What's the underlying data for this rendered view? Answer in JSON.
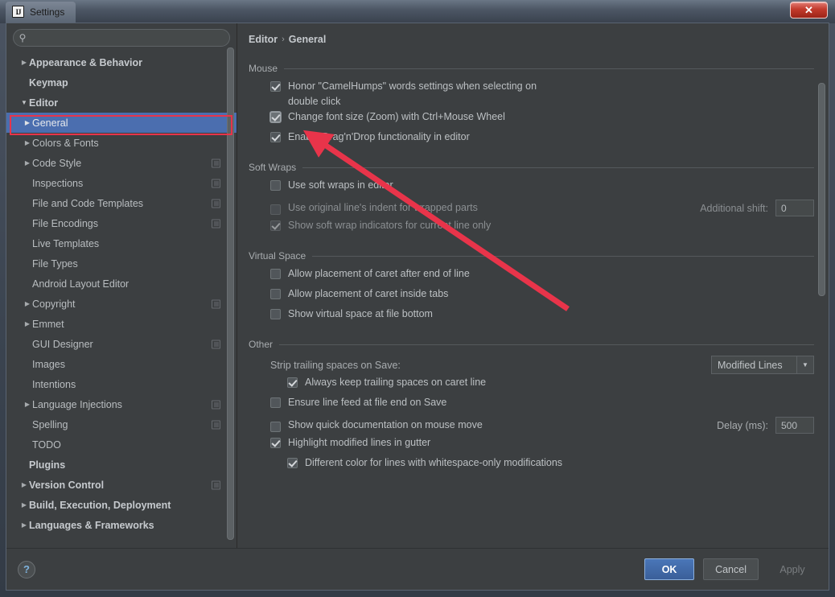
{
  "window": {
    "title": "Settings",
    "logo_text": "IJ",
    "close_label": "✕"
  },
  "sidebar": {
    "search": {
      "value": "",
      "placeholder": "",
      "icon": "search-icon"
    },
    "items": [
      {
        "label": "Appearance & Behavior",
        "indent": 0,
        "arrow": "▶",
        "bold": true,
        "selected": false,
        "cfg": false
      },
      {
        "label": "Keymap",
        "indent": 0,
        "arrow": "",
        "bold": true,
        "selected": false,
        "cfg": false
      },
      {
        "label": "Editor",
        "indent": 0,
        "arrow": "▼",
        "bold": true,
        "selected": false,
        "cfg": false
      },
      {
        "label": "General",
        "indent": 1,
        "arrow": "▶",
        "bold": false,
        "selected": true,
        "cfg": false
      },
      {
        "label": "Colors & Fonts",
        "indent": 1,
        "arrow": "▶",
        "bold": false,
        "selected": false,
        "cfg": false
      },
      {
        "label": "Code Style",
        "indent": 1,
        "arrow": "▶",
        "bold": false,
        "selected": false,
        "cfg": true
      },
      {
        "label": "Inspections",
        "indent": 1,
        "arrow": "",
        "bold": false,
        "selected": false,
        "cfg": true
      },
      {
        "label": "File and Code Templates",
        "indent": 1,
        "arrow": "",
        "bold": false,
        "selected": false,
        "cfg": true
      },
      {
        "label": "File Encodings",
        "indent": 1,
        "arrow": "",
        "bold": false,
        "selected": false,
        "cfg": true
      },
      {
        "label": "Live Templates",
        "indent": 1,
        "arrow": "",
        "bold": false,
        "selected": false,
        "cfg": false
      },
      {
        "label": "File Types",
        "indent": 1,
        "arrow": "",
        "bold": false,
        "selected": false,
        "cfg": false
      },
      {
        "label": "Android Layout Editor",
        "indent": 1,
        "arrow": "",
        "bold": false,
        "selected": false,
        "cfg": false
      },
      {
        "label": "Copyright",
        "indent": 1,
        "arrow": "▶",
        "bold": false,
        "selected": false,
        "cfg": true
      },
      {
        "label": "Emmet",
        "indent": 1,
        "arrow": "▶",
        "bold": false,
        "selected": false,
        "cfg": false
      },
      {
        "label": "GUI Designer",
        "indent": 1,
        "arrow": "",
        "bold": false,
        "selected": false,
        "cfg": true
      },
      {
        "label": "Images",
        "indent": 1,
        "arrow": "",
        "bold": false,
        "selected": false,
        "cfg": false
      },
      {
        "label": "Intentions",
        "indent": 1,
        "arrow": "",
        "bold": false,
        "selected": false,
        "cfg": false
      },
      {
        "label": "Language Injections",
        "indent": 1,
        "arrow": "▶",
        "bold": false,
        "selected": false,
        "cfg": true
      },
      {
        "label": "Spelling",
        "indent": 1,
        "arrow": "",
        "bold": false,
        "selected": false,
        "cfg": true
      },
      {
        "label": "TODO",
        "indent": 1,
        "arrow": "",
        "bold": false,
        "selected": false,
        "cfg": false
      },
      {
        "label": "Plugins",
        "indent": 0,
        "arrow": "",
        "bold": true,
        "selected": false,
        "cfg": false
      },
      {
        "label": "Version Control",
        "indent": 0,
        "arrow": "▶",
        "bold": true,
        "selected": false,
        "cfg": true
      },
      {
        "label": "Build, Execution, Deployment",
        "indent": 0,
        "arrow": "▶",
        "bold": true,
        "selected": false,
        "cfg": false
      },
      {
        "label": "Languages & Frameworks",
        "indent": 0,
        "arrow": "▶",
        "bold": true,
        "selected": false,
        "cfg": false
      }
    ]
  },
  "main": {
    "breadcrumb": {
      "root": "Editor",
      "separator": "›",
      "leaf": "General"
    },
    "groups": [
      {
        "title": "Mouse",
        "rows": [
          {
            "kind": "checkbox",
            "label": "Honor \"CamelHumps\" words settings when selecting on double click",
            "checked": true,
            "enabled": true,
            "focused": false,
            "indent": "normal"
          },
          {
            "kind": "checkbox",
            "label": "Change font size (Zoom) with Ctrl+Mouse Wheel",
            "checked": true,
            "enabled": true,
            "focused": true,
            "indent": "normal"
          },
          {
            "kind": "checkbox",
            "label": "Enable Drag'n'Drop functionality in editor",
            "checked": true,
            "enabled": true,
            "focused": false,
            "indent": "normal"
          }
        ]
      },
      {
        "title": "Soft Wraps",
        "rows": [
          {
            "kind": "checkbox",
            "label": "Use soft wraps in editor",
            "checked": false,
            "enabled": true,
            "focused": false,
            "indent": "normal"
          },
          {
            "kind": "checkbox-field",
            "label": "Use original line's indent for wrapped parts",
            "checked": false,
            "enabled": false,
            "focused": false,
            "indent": "normal",
            "field_label": "Additional shift:",
            "field_value": "0"
          },
          {
            "kind": "checkbox",
            "label": "Show soft wrap indicators for current line only",
            "checked": true,
            "enabled": false,
            "focused": false,
            "indent": "normal"
          }
        ]
      },
      {
        "title": "Virtual Space",
        "rows": [
          {
            "kind": "checkbox",
            "label": "Allow placement of caret after end of line",
            "checked": false,
            "enabled": true,
            "focused": false,
            "indent": "normal"
          },
          {
            "kind": "checkbox",
            "label": "Allow placement of caret inside tabs",
            "checked": false,
            "enabled": true,
            "focused": false,
            "indent": "normal"
          },
          {
            "kind": "checkbox",
            "label": "Show virtual space at file bottom",
            "checked": false,
            "enabled": true,
            "focused": false,
            "indent": "normal"
          }
        ]
      },
      {
        "title": "Other",
        "rows": [
          {
            "kind": "combo-row",
            "label": "Strip trailing spaces on Save:",
            "combo_value": "Modified Lines",
            "combo_arrow": "▼"
          },
          {
            "kind": "checkbox",
            "label": "Always keep trailing spaces on caret line",
            "checked": true,
            "enabled": true,
            "focused": false,
            "indent": "deep"
          },
          {
            "kind": "checkbox",
            "label": "Ensure line feed at file end on Save",
            "checked": false,
            "enabled": true,
            "focused": false,
            "indent": "normal"
          },
          {
            "kind": "checkbox-field",
            "label": "Show quick documentation on mouse move",
            "checked": false,
            "enabled": true,
            "focused": false,
            "indent": "normal",
            "field_label": "Delay (ms):",
            "field_value": "500"
          },
          {
            "kind": "checkbox",
            "label": "Highlight modified lines in gutter",
            "checked": true,
            "enabled": true,
            "focused": false,
            "indent": "normal"
          },
          {
            "kind": "checkbox",
            "label": "Different color for lines with whitespace-only modifications",
            "checked": true,
            "enabled": true,
            "focused": false,
            "indent": "deep"
          }
        ]
      }
    ]
  },
  "footer": {
    "help_label": "?",
    "ok_label": "OK",
    "cancel_label": "Cancel",
    "apply_label": "Apply"
  },
  "annotations": {
    "accent_color": "#e8344a",
    "highlight_target": "General",
    "arrow_points_to": "Change font size (Zoom) with Ctrl+Mouse Wheel"
  }
}
